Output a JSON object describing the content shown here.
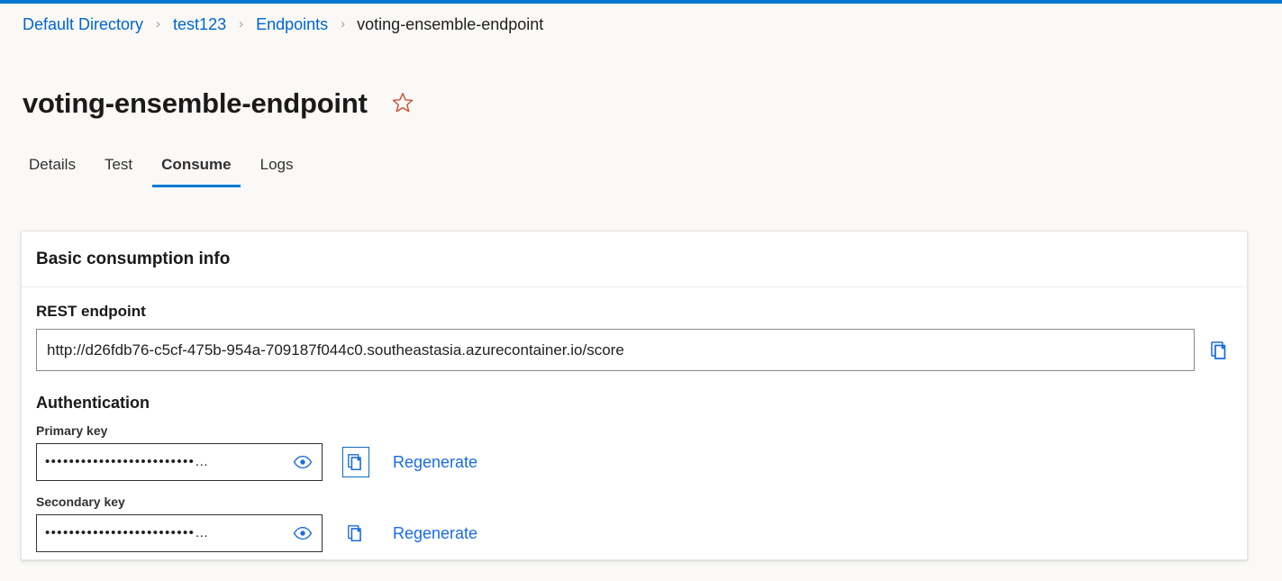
{
  "theme": {
    "accent": "#0078d4",
    "link": "#0066cc",
    "regenerate_link": "#1a6ce0",
    "star": "#c94f2e",
    "page_bg": "#faf9f8",
    "card_bg": "#ffffff"
  },
  "breadcrumb": {
    "items": [
      {
        "label": "Default Directory",
        "current": false
      },
      {
        "label": "test123",
        "current": false
      },
      {
        "label": "Endpoints",
        "current": false
      },
      {
        "label": "voting-ensemble-endpoint",
        "current": true
      }
    ],
    "separator": "›"
  },
  "header": {
    "title": "voting-ensemble-endpoint",
    "favorite_icon": "star-icon"
  },
  "tabs": [
    {
      "label": "Details",
      "active": false
    },
    {
      "label": "Test",
      "active": false
    },
    {
      "label": "Consume",
      "active": true
    },
    {
      "label": "Logs",
      "active": false
    }
  ],
  "card": {
    "title": "Basic consumption info",
    "rest_endpoint": {
      "label": "REST endpoint",
      "value": "http://d26fdb76-c5cf-475b-954a-709187f044c0.southeastasia.azurecontainer.io/score",
      "copy_icon": "copy-icon"
    },
    "authentication": {
      "label": "Authentication",
      "keys": [
        {
          "label": "Primary key",
          "masked_value": "•••••••••••••••••••••••••…",
          "reveal_icon": "eye-icon",
          "copy_icon": "copy-icon",
          "regenerate_label": "Regenerate"
        },
        {
          "label": "Secondary key",
          "masked_value": "•••••••••••••••••••••••••…",
          "reveal_icon": "eye-icon",
          "copy_icon": "copy-icon",
          "regenerate_label": "Regenerate"
        }
      ]
    }
  }
}
